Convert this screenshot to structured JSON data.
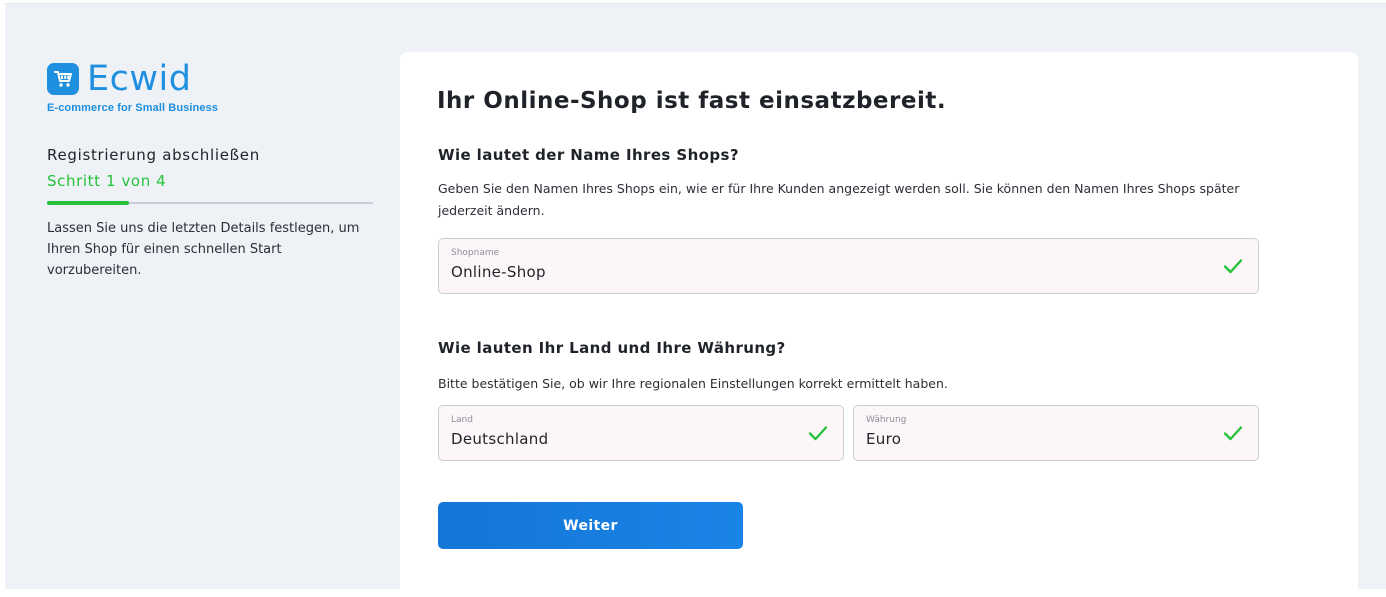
{
  "brand": {
    "name": "Ecwid",
    "tagline": "E-commerce for Small Business",
    "color": "#1f8fe0"
  },
  "sidebar": {
    "title": "Registrierung abschließen",
    "step": "Schritt 1 von 4",
    "progress_fraction": 0.25,
    "description": "Lassen Sie uns die letzten Details festlegen, um Ihren Shop für einen schnellen Start vorzubereiten."
  },
  "main": {
    "title": "Ihr Online-Shop ist fast einsatzbereit.",
    "shop_section": {
      "heading": "Wie lautet der Name Ihres Shops?",
      "text": "Geben Sie den Namen Ihres Shops ein, wie er für Ihre Kunden angezeigt werden soll. Sie können den Namen Ihres Shops später jederzeit ändern.",
      "field_label": "Shopname",
      "field_value": "Online-Shop"
    },
    "region_section": {
      "heading": "Wie lauten Ihr Land und Ihre Währung?",
      "text": "Bitte bestätigen Sie, ob wir Ihre regionalen Einstellungen korrekt ermittelt haben.",
      "country_label": "Land",
      "country_value": "Deutschland",
      "currency_label": "Währung",
      "currency_value": "Euro"
    },
    "next_button": "Weiter"
  },
  "colors": {
    "accent": "#1f8fe0",
    "success": "#25c23a",
    "button": "#1476d6"
  }
}
